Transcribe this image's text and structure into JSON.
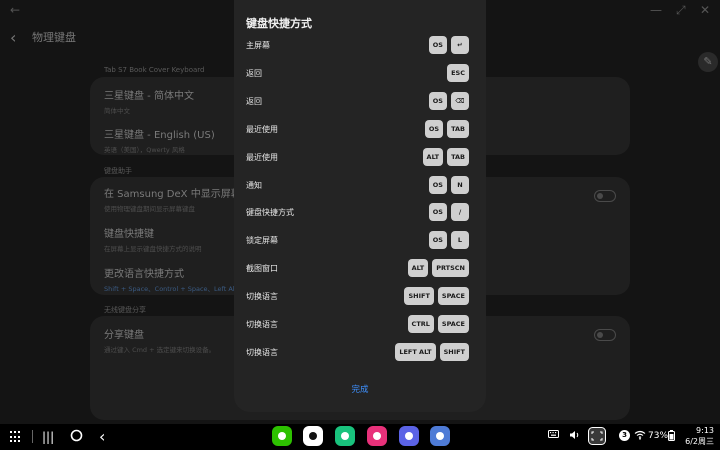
{
  "background": {
    "page_title": "物理键盘",
    "section_keyboard": "Tab S7 Book Cover Keyboard",
    "item_samsung_cn": "三星键盘 - 简体中文",
    "item_samsung_cn_sub": "简体中文",
    "item_samsung_en": "三星键盘 - English (US)",
    "item_samsung_en_sub": "英语（美国），Qwerty 风格",
    "section_assist": "键盘助手",
    "item_dex": "在 Samsung DeX 中显示屏幕键",
    "item_dex_sub": "使用物理键盘期间显示屏幕键盘",
    "item_shortcuts": "键盘快捷键",
    "item_shortcuts_sub": "在屏幕上显示键盘快捷方式的说明",
    "item_lang": "更改语言快捷方式",
    "item_lang_sub": "Shift + Space、Control + Space、Left Alt",
    "section_wireless": "无线键盘分享",
    "item_share": "分享键盘",
    "item_share_sub": "通过键入 Cmd + 选定键来切换设备。"
  },
  "dialog": {
    "title": "键盘快捷方式",
    "shortcuts": [
      {
        "label": "主屏幕",
        "keys": [
          "OS",
          "↵"
        ]
      },
      {
        "label": "返回",
        "keys": [
          "ESC"
        ]
      },
      {
        "label": "返回",
        "keys": [
          "OS",
          "⌫"
        ]
      },
      {
        "label": "最近使用",
        "keys": [
          "OS",
          "TAB"
        ]
      },
      {
        "label": "最近使用",
        "keys": [
          "ALT",
          "TAB"
        ]
      },
      {
        "label": "通知",
        "keys": [
          "OS",
          "N"
        ]
      },
      {
        "label": "键盘快捷方式",
        "keys": [
          "OS",
          "/"
        ]
      },
      {
        "label": "锁定屏幕",
        "keys": [
          "OS",
          "L"
        ]
      },
      {
        "label": "截图窗口",
        "keys": [
          "ALT",
          "PRTSCN"
        ]
      },
      {
        "label": "切换语言",
        "keys": [
          "SHIFT",
          "SPACE"
        ]
      },
      {
        "label": "切换语言",
        "keys": [
          "CTRL",
          "SPACE"
        ]
      },
      {
        "label": "切换语言",
        "keys": [
          "LEFT ALT",
          "SHIFT"
        ]
      }
    ],
    "done_label": "完成"
  },
  "taskbar": {
    "apps": [
      {
        "name": "wechat",
        "color": "#2dc100"
      },
      {
        "name": "qq",
        "color": "#ffffff"
      },
      {
        "name": "connect",
        "color": "#19c37d"
      },
      {
        "name": "flower",
        "color": "#e8317a"
      },
      {
        "name": "samsung-internet",
        "color": "#5b63e6"
      },
      {
        "name": "settings",
        "color": "#4e7bd6"
      }
    ],
    "notification_count": "3",
    "battery": "73%",
    "time": "9:13",
    "date": "6/2周三"
  },
  "colors": {
    "accent": "#3e91ff",
    "dialog_bg": "#242424",
    "key_bg": "#cfcfcf"
  }
}
